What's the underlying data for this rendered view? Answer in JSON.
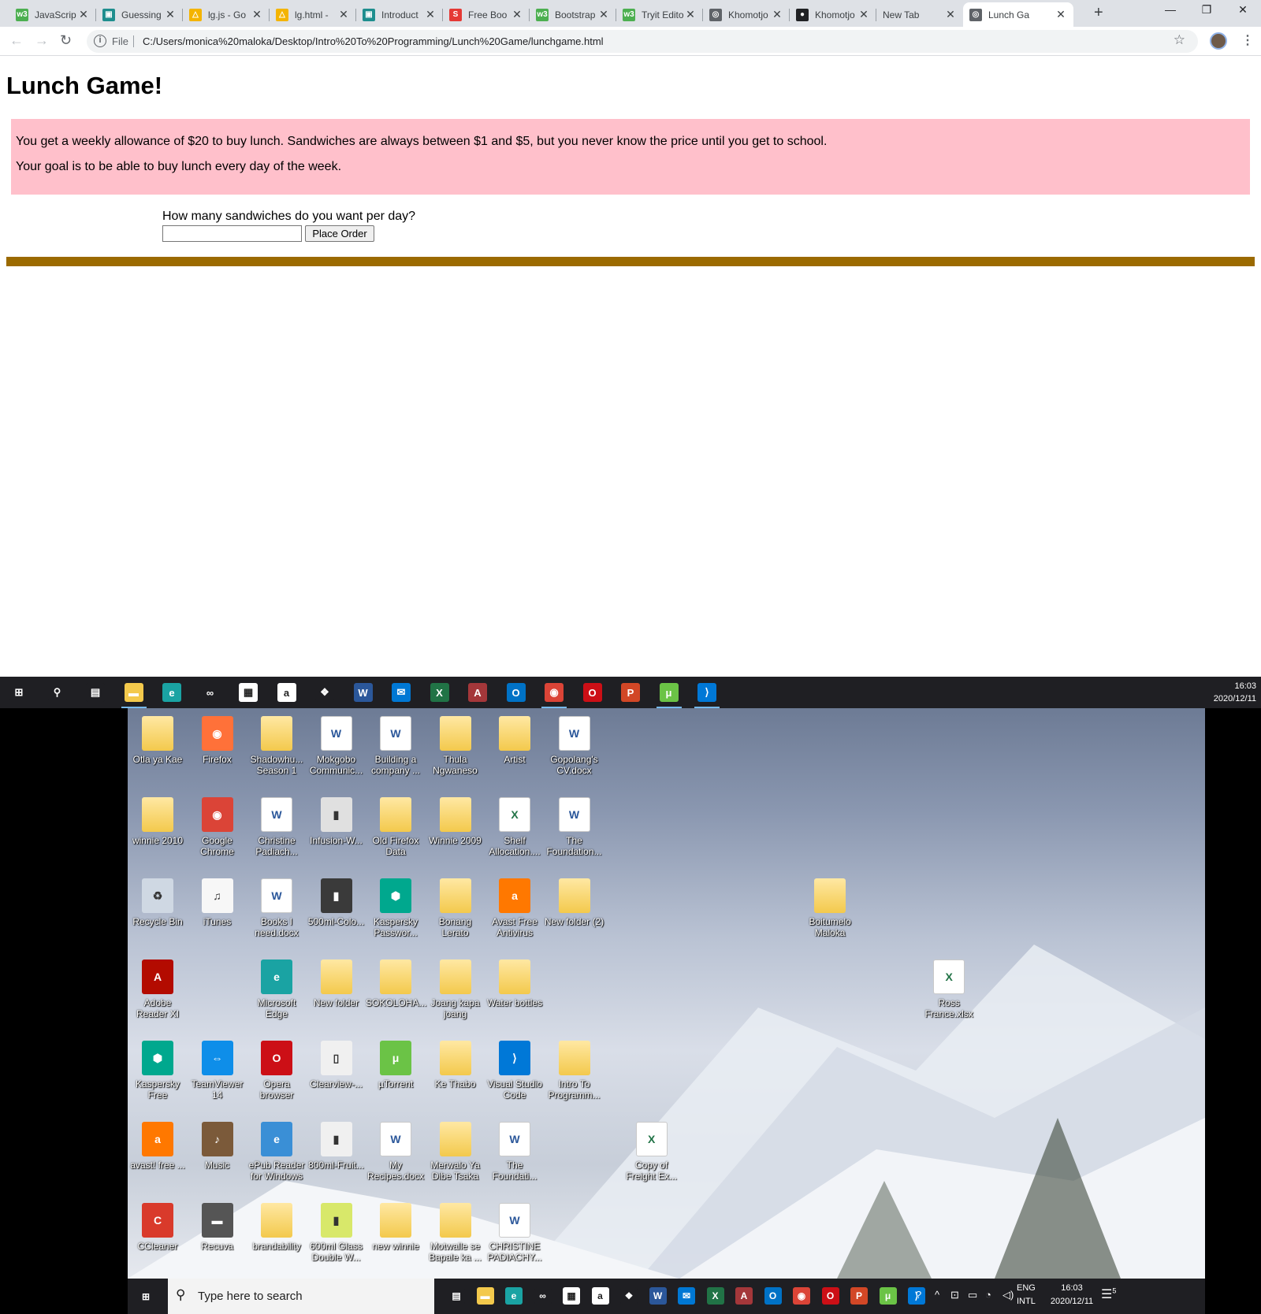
{
  "browser": {
    "tabs": [
      {
        "title": "JavaScrip",
        "icon": "w3schools-icon",
        "color": "#4caf50",
        "glyph": "w3"
      },
      {
        "title": "Guessing",
        "icon": "classroom-icon",
        "color": "#1e8e8e",
        "glyph": "▣"
      },
      {
        "title": "lg.js - Go",
        "icon": "google-drive-icon",
        "color": "#f4b400",
        "glyph": "△"
      },
      {
        "title": "lg.html -",
        "icon": "google-drive-icon",
        "color": "#f4b400",
        "glyph": "△"
      },
      {
        "title": "Introduct",
        "icon": "classroom-icon",
        "color": "#1e8e8e",
        "glyph": "▣"
      },
      {
        "title": "Free Boo",
        "icon": "s-icon",
        "color": "#e53935",
        "glyph": "S"
      },
      {
        "title": "Bootstrap",
        "icon": "w3schools-icon",
        "color": "#4caf50",
        "glyph": "w3"
      },
      {
        "title": "Tryit Edito",
        "icon": "w3schools-icon",
        "color": "#4caf50",
        "glyph": "w3"
      },
      {
        "title": "Khomotjo",
        "icon": "globe-icon",
        "color": "#5f6368",
        "glyph": "◎"
      },
      {
        "title": "Khomotjo",
        "icon": "github-icon",
        "color": "#202124",
        "glyph": "●"
      },
      {
        "title": "New Tab",
        "icon": "",
        "color": "",
        "glyph": ""
      },
      {
        "title": "Lunch Ga",
        "icon": "globe-icon",
        "color": "#5f6368",
        "glyph": "◎"
      }
    ],
    "address": {
      "prefix": "File",
      "url": "C:/Users/monica%20maloka/Desktop/Intro%20To%20Programming/Lunch%20Game/lunchgame.html"
    }
  },
  "page": {
    "title": "Lunch Game!",
    "intro_line1": "You get a weekly allowance of $20 to buy lunch. Sandwiches are always between $1 and $5, but you never know the price until you get to school.",
    "intro_line2": "Your goal is to be able to buy lunch every day of the week.",
    "question": "How many sandwiches do you want per day?",
    "quantity_value": "",
    "order_button": "Place Order",
    "intro_bg": "#ffc0cb",
    "rule_color": "#9b6a00"
  },
  "taskbar": {
    "time": "16:03",
    "date": "2020/12/11",
    "apps": [
      {
        "name": "start-icon",
        "color": "#1f1f23",
        "glyph": "⊞"
      },
      {
        "name": "search-icon",
        "color": "#1f1f23",
        "glyph": "⚲"
      },
      {
        "name": "task-view-icon",
        "color": "#1f1f23",
        "glyph": "▤"
      },
      {
        "name": "file-explorer-icon",
        "color": "#f3c94c",
        "glyph": "▬"
      },
      {
        "name": "edge-icon",
        "color": "#1aa3a3",
        "glyph": "e"
      },
      {
        "name": "infinity-icon",
        "color": "#1f1f23",
        "glyph": "∞"
      },
      {
        "name": "store-icon",
        "color": "#ffffff",
        "glyph": "▦"
      },
      {
        "name": "amazon-icon",
        "color": "#ffffff",
        "glyph": "a"
      },
      {
        "name": "dropbox-icon",
        "color": "#1f1f23",
        "glyph": "❖"
      },
      {
        "name": "word-icon",
        "color": "#2b579a",
        "glyph": "W"
      },
      {
        "name": "mail-icon",
        "color": "#0078d4",
        "glyph": "✉"
      },
      {
        "name": "excel-icon",
        "color": "#217346",
        "glyph": "X"
      },
      {
        "name": "access-icon",
        "color": "#a4373a",
        "glyph": "A"
      },
      {
        "name": "outlook-icon",
        "color": "#0072c6",
        "glyph": "O"
      },
      {
        "name": "chrome-icon",
        "color": "#db4437",
        "glyph": "◉"
      },
      {
        "name": "opera-icon",
        "color": "#cc0f16",
        "glyph": "O"
      },
      {
        "name": "powerpoint-icon",
        "color": "#d24726",
        "glyph": "P"
      },
      {
        "name": "utorrent-icon",
        "color": "#6bc346",
        "glyph": "μ"
      },
      {
        "name": "vscode-icon",
        "color": "#0078d7",
        "glyph": "⟩"
      }
    ]
  },
  "desktop": {
    "icons": [
      {
        "label": "Otla ya Kae",
        "kind": "folder"
      },
      {
        "label": "Firefox",
        "kind": "app",
        "color": "#ff7139",
        "glyph": "◉"
      },
      {
        "label": "Shadowhu... Season 1",
        "kind": "folder"
      },
      {
        "label": "Mokgobo Communic...",
        "kind": "word"
      },
      {
        "label": "Building a company ...",
        "kind": "word"
      },
      {
        "label": "Thula Ngwaneso",
        "kind": "folder"
      },
      {
        "label": "Artist",
        "kind": "folder"
      },
      {
        "label": "Gopolang's CV.docx",
        "kind": "word"
      },
      {
        "label": "winnie 2010",
        "kind": "folder"
      },
      {
        "label": "Google Chrome",
        "kind": "app",
        "color": "#db4437",
        "glyph": "◉"
      },
      {
        "label": "Christine Padiach...",
        "kind": "word"
      },
      {
        "label": "Infusion-W...",
        "kind": "app",
        "color": "#e0e0e0",
        "glyph": "▮"
      },
      {
        "label": "Old Firefox Data",
        "kind": "folder"
      },
      {
        "label": "Winnie 2009",
        "kind": "folder"
      },
      {
        "label": "Shelf Allocation....",
        "kind": "excel"
      },
      {
        "label": "The Foundation...",
        "kind": "word"
      },
      {
        "label": "Recycle Bin",
        "kind": "app",
        "color": "#cfd8e3",
        "glyph": "♻"
      },
      {
        "label": "iTunes",
        "kind": "app",
        "color": "#f7f7f7",
        "glyph": "♫"
      },
      {
        "label": "Books I need.docx",
        "kind": "word"
      },
      {
        "label": "500ml-Colo...",
        "kind": "app",
        "color": "#3a3a3a",
        "glyph": "▮"
      },
      {
        "label": "Kaspersky Passwor...",
        "kind": "app",
        "color": "#00a88e",
        "glyph": "⬢"
      },
      {
        "label": "Bonang Lerato",
        "kind": "folder"
      },
      {
        "label": "Avast Free Antivirus",
        "kind": "app",
        "color": "#ff7800",
        "glyph": "a"
      },
      {
        "label": "New folder (2)",
        "kind": "folder"
      },
      {
        "label": "Boitumelo Maloka",
        "kind": "folder"
      },
      {
        "label": "Adobe Reader XI",
        "kind": "app",
        "color": "#b30b00",
        "glyph": "A"
      },
      {
        "label": "Microsoft Edge",
        "kind": "app",
        "color": "#1aa3a3",
        "glyph": "e"
      },
      {
        "label": "New folder",
        "kind": "folder"
      },
      {
        "label": "SOKOLOHA...",
        "kind": "folder"
      },
      {
        "label": "Joang kapa joang",
        "kind": "folder"
      },
      {
        "label": "Water bottles",
        "kind": "folder"
      },
      {
        "label": "Ross France.xlsx",
        "kind": "excel"
      },
      {
        "label": "Kaspersky Free",
        "kind": "app",
        "color": "#00a88e",
        "glyph": "⬢"
      },
      {
        "label": "TeamViewer 14",
        "kind": "app",
        "color": "#0e8ee9",
        "glyph": "⇔"
      },
      {
        "label": "Opera browser",
        "kind": "app",
        "color": "#cc0f16",
        "glyph": "O"
      },
      {
        "label": "Clearview-...",
        "kind": "app",
        "color": "#f0f0f0",
        "glyph": "▯"
      },
      {
        "label": "µTorrent",
        "kind": "app",
        "color": "#6bc346",
        "glyph": "μ"
      },
      {
        "label": "Ke Thabo",
        "kind": "folder"
      },
      {
        "label": "Visual Studio Code",
        "kind": "app",
        "color": "#0078d7",
        "glyph": "⟩"
      },
      {
        "label": "Intro To Programm...",
        "kind": "folder"
      },
      {
        "label": "avast! free ...",
        "kind": "app",
        "color": "#ff7800",
        "glyph": "a"
      },
      {
        "label": "Music",
        "kind": "app",
        "color": "#7b5a3a",
        "glyph": "♪"
      },
      {
        "label": "ePub Reader for Windows",
        "kind": "app",
        "color": "#3a8fd6",
        "glyph": "e"
      },
      {
        "label": "800ml-Fruit...",
        "kind": "app",
        "color": "#f0f0f0",
        "glyph": "▮"
      },
      {
        "label": "My Recipes.docx",
        "kind": "word"
      },
      {
        "label": "Merwalo Ya Dibe Tsaka",
        "kind": "folder"
      },
      {
        "label": "The Foundati...",
        "kind": "word"
      },
      {
        "label": "Copy of Freight Ex...",
        "kind": "excel"
      },
      {
        "label": "CCleaner",
        "kind": "app",
        "color": "#d93a2b",
        "glyph": "C"
      },
      {
        "label": "Recuva",
        "kind": "app",
        "color": "#555555",
        "glyph": "▬"
      },
      {
        "label": "brandability",
        "kind": "folder"
      },
      {
        "label": "600ml Glass Double W...",
        "kind": "app",
        "color": "#d8e86a",
        "glyph": "▮"
      },
      {
        "label": "new winnie",
        "kind": "folder"
      },
      {
        "label": "Motwalle se Bapale ka ...",
        "kind": "folder"
      },
      {
        "label": "CHRISTINE PADIACHY...",
        "kind": "word"
      }
    ]
  },
  "taskbar2": {
    "search_placeholder": "Type here to search",
    "lang_line1": "ENG",
    "lang_line2": "INTL",
    "time": "16:03",
    "date": "2020/12/11",
    "notifications": "5",
    "apps": [
      {
        "name": "task-view-icon",
        "color": "#1f1f23",
        "glyph": "▤"
      },
      {
        "name": "file-explorer-icon",
        "color": "#f3c94c",
        "glyph": "▬"
      },
      {
        "name": "edge-icon",
        "color": "#1aa3a3",
        "glyph": "e"
      },
      {
        "name": "infinity-icon",
        "color": "#1f1f23",
        "glyph": "∞"
      },
      {
        "name": "store-icon",
        "color": "#ffffff",
        "glyph": "▦"
      },
      {
        "name": "amazon-icon",
        "color": "#ffffff",
        "glyph": "a"
      },
      {
        "name": "dropbox-icon",
        "color": "#1f1f23",
        "glyph": "❖"
      },
      {
        "name": "word-icon",
        "color": "#2b579a",
        "glyph": "W"
      },
      {
        "name": "mail-icon",
        "color": "#0078d4",
        "glyph": "✉"
      },
      {
        "name": "excel-icon",
        "color": "#217346",
        "glyph": "X"
      },
      {
        "name": "access-icon",
        "color": "#a4373a",
        "glyph": "A"
      },
      {
        "name": "outlook-icon",
        "color": "#0072c6",
        "glyph": "O"
      },
      {
        "name": "chrome-icon",
        "color": "#db4437",
        "glyph": "◉"
      },
      {
        "name": "opera-icon",
        "color": "#cc0f16",
        "glyph": "O"
      },
      {
        "name": "powerpoint-icon",
        "color": "#d24726",
        "glyph": "P"
      },
      {
        "name": "utorrent-icon",
        "color": "#6bc346",
        "glyph": "μ"
      },
      {
        "name": "vscode-icon",
        "color": "#0078d7",
        "glyph": "⟩"
      }
    ]
  }
}
